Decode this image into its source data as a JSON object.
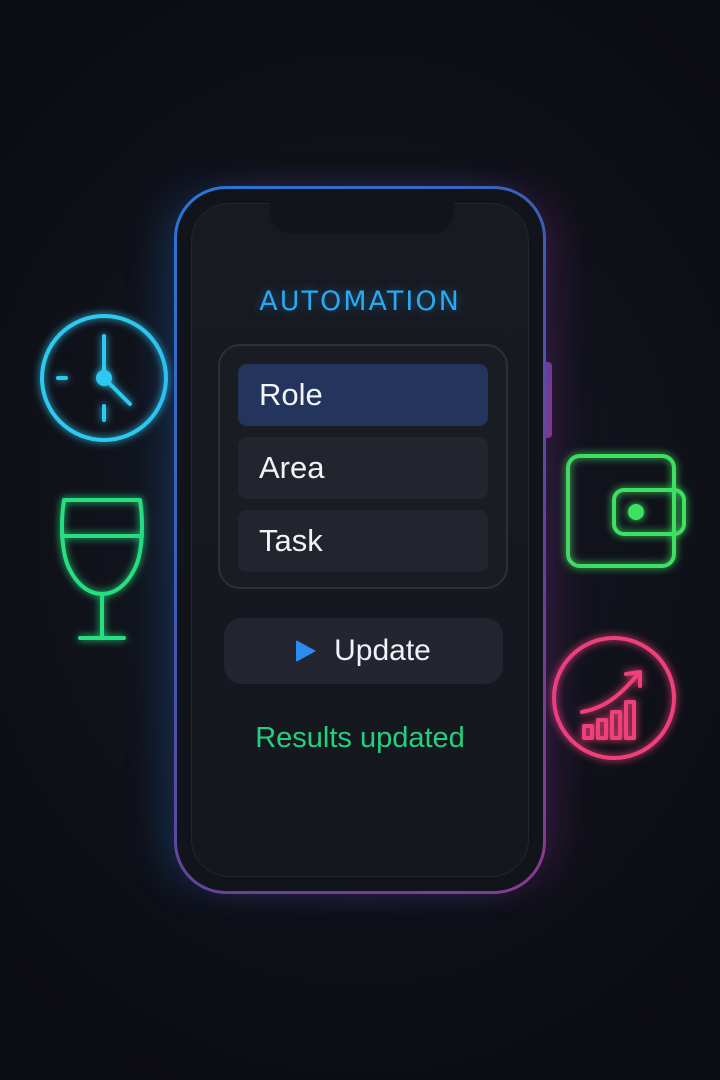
{
  "app": {
    "title": "AUTOMATION"
  },
  "options": [
    {
      "label": "Role",
      "selected": true
    },
    {
      "label": "Area",
      "selected": false
    },
    {
      "label": "Task",
      "selected": false
    }
  ],
  "update_button": {
    "label": "Update",
    "icon": "play-icon"
  },
  "status": {
    "text": "Results updated"
  },
  "decorative_icons": [
    {
      "name": "clock-icon",
      "color": "#2ec9f0"
    },
    {
      "name": "wine-glass-icon",
      "color": "#27e080"
    },
    {
      "name": "wallet-icon",
      "color": "#3ee060"
    },
    {
      "name": "growth-chart-icon",
      "color": "#f0407a"
    }
  ],
  "colors": {
    "accent_blue": "#29a9f2",
    "selected_option_bg": "#23345d",
    "status_green": "#22d07e",
    "background": "#0d0f16"
  }
}
